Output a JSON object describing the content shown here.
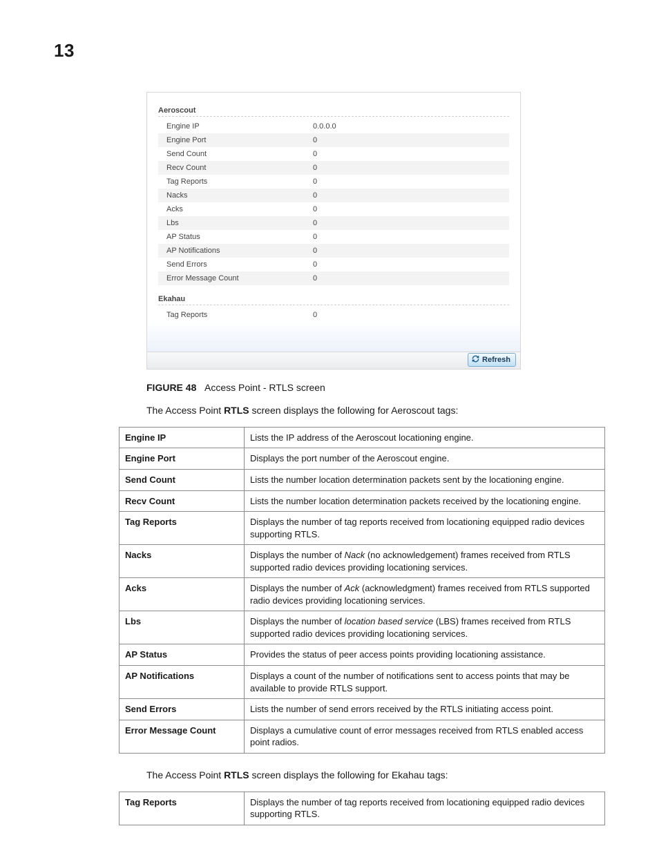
{
  "page_number": "13",
  "screenshot": {
    "aeroscout": {
      "title": "Aeroscout",
      "rows": [
        {
          "label": "Engine IP",
          "value": "0.0.0.0"
        },
        {
          "label": "Engine Port",
          "value": "0"
        },
        {
          "label": "Send Count",
          "value": "0"
        },
        {
          "label": "Recv Count",
          "value": "0"
        },
        {
          "label": "Tag Reports",
          "value": "0"
        },
        {
          "label": "Nacks",
          "value": "0"
        },
        {
          "label": "Acks",
          "value": "0"
        },
        {
          "label": "Lbs",
          "value": "0"
        },
        {
          "label": "AP Status",
          "value": "0"
        },
        {
          "label": "AP Notifications",
          "value": "0"
        },
        {
          "label": "Send Errors",
          "value": "0"
        },
        {
          "label": "Error Message Count",
          "value": "0"
        }
      ]
    },
    "ekahau": {
      "title": "Ekahau",
      "rows": [
        {
          "label": "Tag Reports",
          "value": "0"
        }
      ]
    },
    "refresh_label": "Refresh"
  },
  "figure": {
    "label": "FIGURE 48",
    "caption": "Access Point - RTLS screen"
  },
  "para_aeroscout_pre": "The Access Point ",
  "para_aeroscout_bold": "RTLS",
  "para_aeroscout_post": " screen displays the following for Aeroscout tags:",
  "table_aeroscout": [
    {
      "term": "Engine IP",
      "desc": "Lists the IP address of the Aeroscout locationing engine."
    },
    {
      "term": "Engine Port",
      "desc": "Displays the port number of the Aeroscout engine."
    },
    {
      "term": "Send Count",
      "desc": "Lists the number location determination packets sent by the locationing engine."
    },
    {
      "term": "Recv Count",
      "desc": "Lists the number location determination packets received by the locationing engine."
    },
    {
      "term": "Tag Reports",
      "desc": "Displays the number of tag reports received from locationing equipped radio devices supporting RTLS."
    },
    {
      "term": "Nacks",
      "desc_pre": "Displays the number of ",
      "desc_em": "Nack",
      "desc_post": " (no acknowledgement) frames received from RTLS supported radio devices providing locationing services."
    },
    {
      "term": "Acks",
      "desc_pre": "Displays the number of ",
      "desc_em": "Ack",
      "desc_post": " (acknowledgment) frames received from RTLS supported radio devices providing locationing services."
    },
    {
      "term": "Lbs",
      "desc_pre": "Displays the number of ",
      "desc_em": "location based service",
      "desc_post": " (LBS) frames received from RTLS supported radio devices providing locationing services."
    },
    {
      "term": "AP Status",
      "desc": "Provides the status of peer access points providing locationing assistance."
    },
    {
      "term": "AP Notifications",
      "desc": "Displays a count of the number of notifications sent to access points that may be available to provide RTLS support."
    },
    {
      "term": "Send Errors",
      "desc": "Lists the number of send errors received by the RTLS initiating access point."
    },
    {
      "term": "Error Message Count",
      "desc": "Displays a cumulative count of error messages received from RTLS enabled access point radios."
    }
  ],
  "para_ekahau_pre": "The Access Point ",
  "para_ekahau_bold": "RTLS",
  "para_ekahau_post": " screen displays the following for Ekahau tags:",
  "table_ekahau": [
    {
      "term": "Tag Reports",
      "desc": "Displays the number of tag reports received from locationing equipped radio devices supporting RTLS."
    }
  ]
}
